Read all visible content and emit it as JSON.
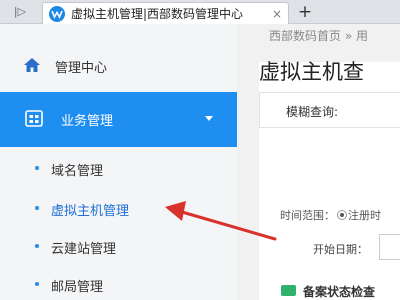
{
  "browser": {
    "nav_glyph": "|▷",
    "tab_title": "虚拟主机管理|西部数码管理中心",
    "tab_close": "×",
    "new_tab": "+"
  },
  "sidebar": {
    "top_item": {
      "label": "管理中心",
      "icon": "home-icon"
    },
    "active_group": {
      "label": "业务管理",
      "icon": "grid-icon"
    },
    "sub_items": [
      {
        "label": "域名管理"
      },
      {
        "label": "虚拟主机管理",
        "current": true
      },
      {
        "label": "云建站管理"
      },
      {
        "label": "邮局管理"
      }
    ]
  },
  "main": {
    "breadcrumb": "西部数码首页  »  用",
    "page_title": "虚拟主机查",
    "filter_label": "模糊查询:",
    "filter_extra": "▾",
    "time_range_label": "时间范围：",
    "time_range_option": "注册时",
    "start_date_label": "开始日期：",
    "status_label": "备案状态检查"
  },
  "colors": {
    "accent": "#1f8ef1",
    "arrow": "#d9312b"
  }
}
